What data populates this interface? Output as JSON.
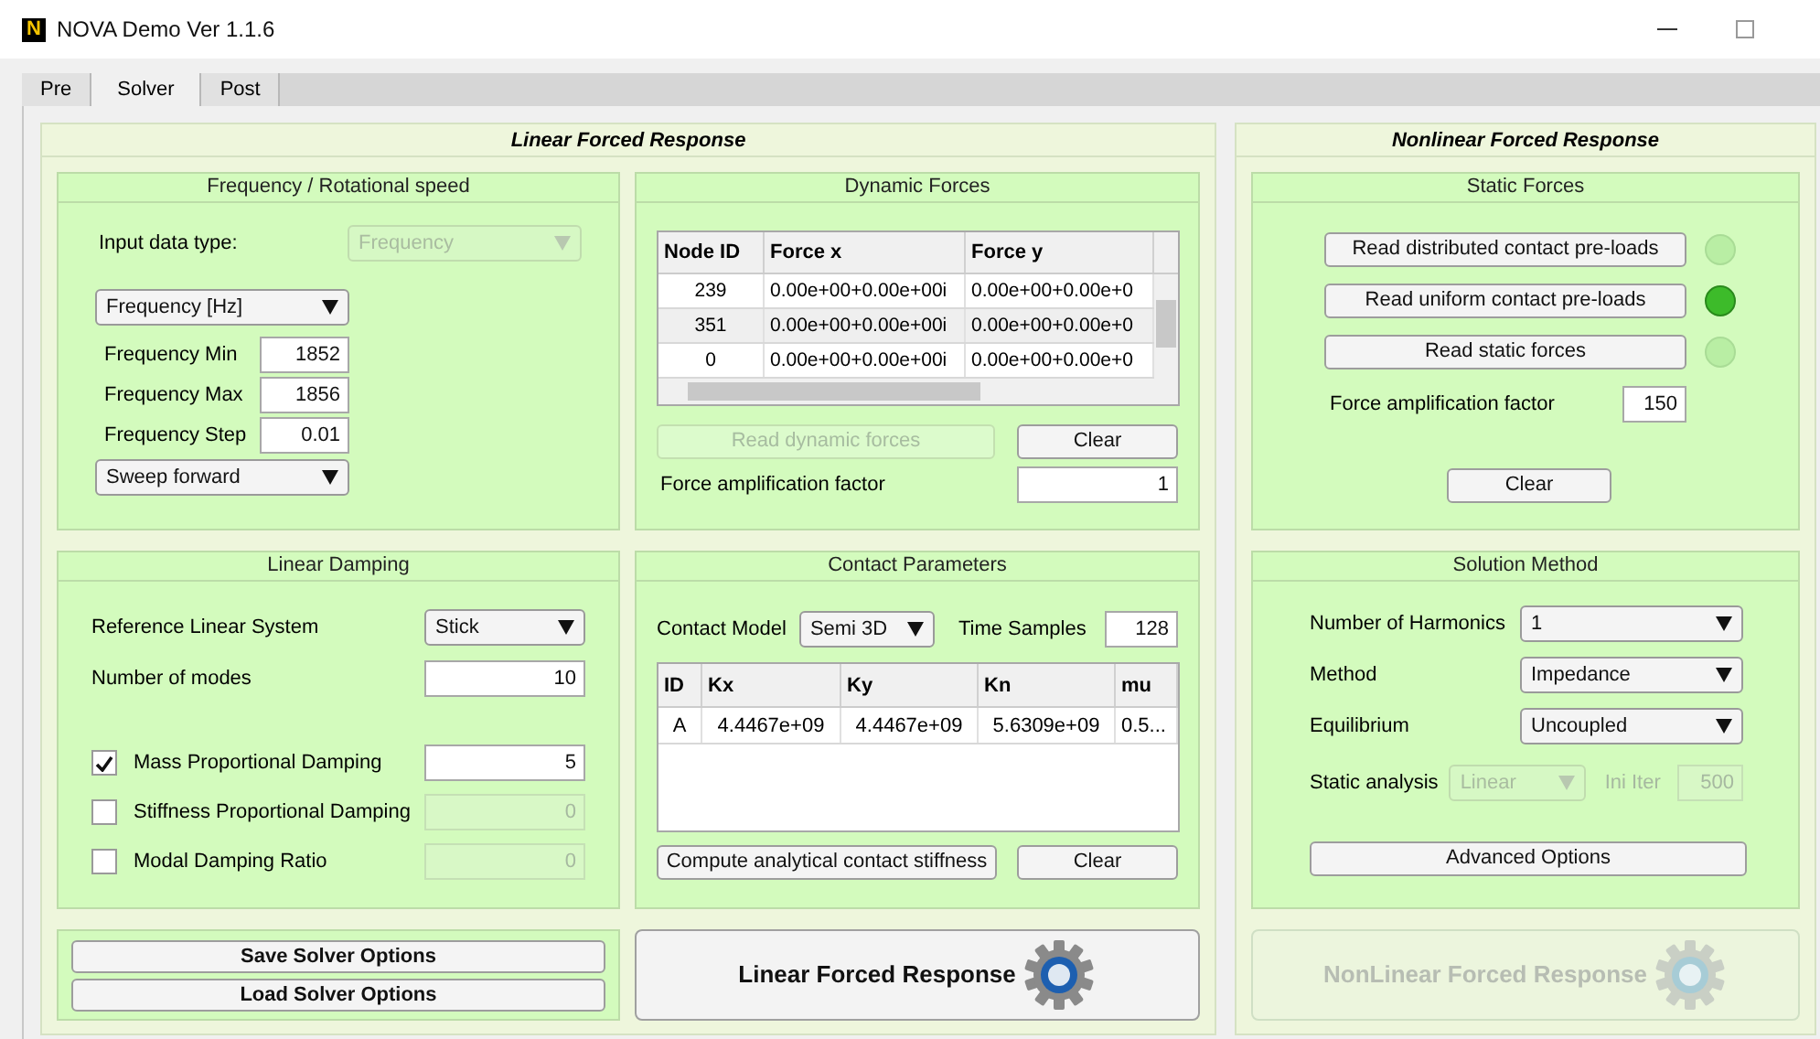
{
  "window": {
    "title": "NOVA Demo Ver 1.1.6",
    "logo": "N"
  },
  "tabs": [
    {
      "label": "Pre",
      "selected": false
    },
    {
      "label": "Solver",
      "selected": true
    },
    {
      "label": "Post",
      "selected": false
    }
  ],
  "linear": {
    "title": "Linear Forced Response",
    "frequency": {
      "title": "Frequency / Rotational speed",
      "input_type_label": "Input data type:",
      "input_type": {
        "value": "Frequency",
        "disabled": true
      },
      "unit": "Frequency [Hz]",
      "fields": [
        {
          "label": "Frequency Min",
          "value": "1852"
        },
        {
          "label": "Frequency Max",
          "value": "1856"
        },
        {
          "label": "Frequency Step",
          "value": "0.01"
        }
      ],
      "sweep": "Sweep forward"
    },
    "dynamic_forces": {
      "title": "Dynamic Forces",
      "table": {
        "columns": [
          "Node ID",
          "Force x",
          "Force y"
        ],
        "rows": [
          [
            "239",
            "0.00e+00+0.00e+00i",
            "0.00e+00+0.00e+0"
          ],
          [
            "351",
            "0.00e+00+0.00e+00i",
            "0.00e+00+0.00e+0"
          ],
          [
            "0",
            "0.00e+00+0.00e+00i",
            "0.00e+00+0.00e+0"
          ]
        ]
      },
      "read_button": {
        "label": "Read dynamic forces",
        "disabled": true
      },
      "clear_button": "Clear",
      "amp_label": "Force amplification factor",
      "amp_value": "1"
    },
    "damping": {
      "title": "Linear Damping",
      "reference_label": "Reference Linear System",
      "reference_value": "Stick",
      "modes_label": "Number of modes",
      "modes_value": "10",
      "options": [
        {
          "label": "Mass Proportional Damping",
          "checked": true,
          "value": "5"
        },
        {
          "label": "Stiffness Proportional Damping",
          "checked": false,
          "value": "0"
        },
        {
          "label": "Modal Damping Ratio",
          "checked": false,
          "value": "0"
        }
      ]
    },
    "contact": {
      "title": "Contact Parameters",
      "model_label": "Contact Model",
      "model_value": "Semi 3D",
      "samples_label": "Time Samples",
      "samples_value": "128",
      "table": {
        "columns": [
          "ID",
          "Kx",
          "Ky",
          "Kn",
          "mu"
        ],
        "rows": [
          [
            "A",
            "4.4467e+09",
            "4.4467e+09",
            "5.6309e+09",
            "0.5..."
          ]
        ]
      },
      "compute_button": "Compute analytical contact stiffness",
      "clear_button": "Clear"
    },
    "option_buttons": [
      "Save Solver Options",
      "Load Solver Options"
    ],
    "run_button": {
      "label": "Linear Forced Response",
      "disabled": false
    }
  },
  "nonlinear": {
    "title": "Nonlinear Forced Response",
    "static_forces": {
      "title": "Static Forces",
      "reads": [
        {
          "label": "Read distributed contact pre-loads",
          "on": false
        },
        {
          "label": "Read uniform contact pre-loads",
          "on": true
        },
        {
          "label": "Read static forces",
          "on": false
        }
      ],
      "amp_label": "Force amplification factor",
      "amp_value": "150",
      "clear_button": "Clear"
    },
    "solution": {
      "title": "Solution Method",
      "selects": [
        {
          "label": "Number of Harmonics",
          "value": "1"
        },
        {
          "label": "Method",
          "value": "Impedance"
        },
        {
          "label": "Equilibrium",
          "value": "Uncoupled"
        }
      ],
      "static_label": "Static analysis",
      "static_value": {
        "value": "Linear",
        "disabled": true
      },
      "ini_label": "Ini Iter",
      "ini_value": {
        "value": "500",
        "disabled": true
      },
      "advanced_button": "Advanced Options"
    },
    "run_button": {
      "label": "NonLinear Forced Response",
      "disabled": true
    }
  }
}
